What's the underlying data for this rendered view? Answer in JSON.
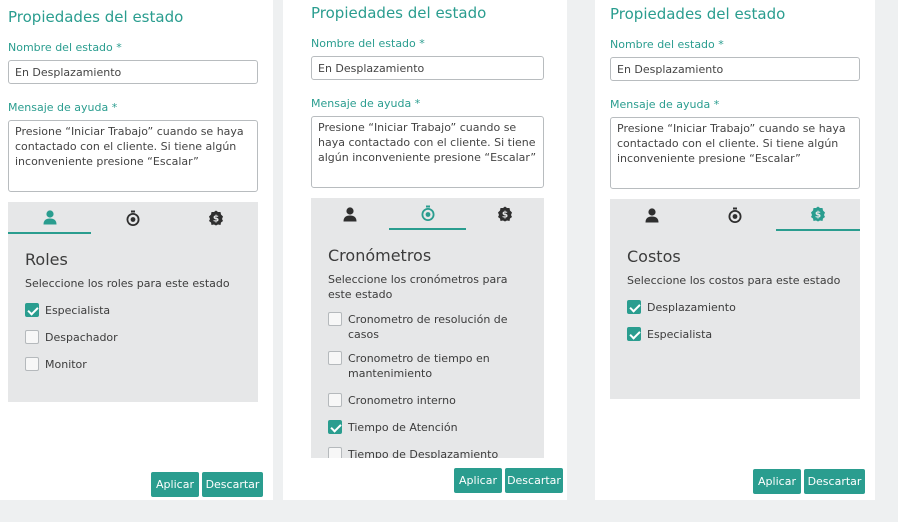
{
  "panels": [
    {
      "title": "Propiedades del estado",
      "name_label": "Nombre del estado *",
      "name_value": "En Desplazamiento",
      "help_label": "Mensaje de ayuda *",
      "help_value": "Presione “Iniciar Trabajo” cuando se haya contactado con el cliente. Si tiene algún inconveniente presione “Escalar”",
      "active_tab": "roles",
      "section_title": "Roles",
      "section_desc": "Seleccione los roles para este estado",
      "items": [
        {
          "label": "Especialista",
          "checked": true
        },
        {
          "label": "Despachador",
          "checked": false
        },
        {
          "label": "Monitor",
          "checked": false
        }
      ],
      "apply_label": "Aplicar",
      "discard_label": "Descartar"
    },
    {
      "title": "Propiedades del estado",
      "name_label": "Nombre del estado *",
      "name_value": "En Desplazamiento",
      "help_label": "Mensaje de ayuda *",
      "help_value": "Presione “Iniciar Trabajo” cuando se haya contactado con el cliente. Si tiene algún inconveniente presione “Escalar”",
      "active_tab": "cronometros",
      "section_title": "Cronómetros",
      "section_desc": "Seleccione los cronómetros para este estado",
      "items": [
        {
          "label": "Cronometro de resolución de casos",
          "checked": false
        },
        {
          "label": "Cronometro de tiempo en mantenimiento",
          "checked": false
        },
        {
          "label": "Cronometro interno",
          "checked": false
        },
        {
          "label": "Tiempo de Atención",
          "checked": true
        },
        {
          "label": "Tiempo de Desplazamiento",
          "checked": false
        }
      ],
      "apply_label": "Aplicar",
      "discard_label": "Descartar"
    },
    {
      "title": "Propiedades del estado",
      "name_label": "Nombre del estado *",
      "name_value": "En Desplazamiento",
      "help_label": "Mensaje de ayuda *",
      "help_value": "Presione “Iniciar Trabajo” cuando se haya contactado con el cliente. Si tiene algún inconveniente presione “Escalar”",
      "active_tab": "costos",
      "section_title": "Costos",
      "section_desc": "Seleccione los costos para este estado",
      "items": [
        {
          "label": "Desplazamiento",
          "checked": true
        },
        {
          "label": "Especialista",
          "checked": true
        }
      ],
      "apply_label": "Aplicar",
      "discard_label": "Descartar"
    }
  ],
  "tab_icons": [
    "user-icon",
    "stopwatch-icon",
    "dollar-coin-icon"
  ],
  "colors": {
    "accent": "#2a9d8f",
    "tab_bg": "#e6e7e8",
    "icon": "#2f2f2f"
  }
}
